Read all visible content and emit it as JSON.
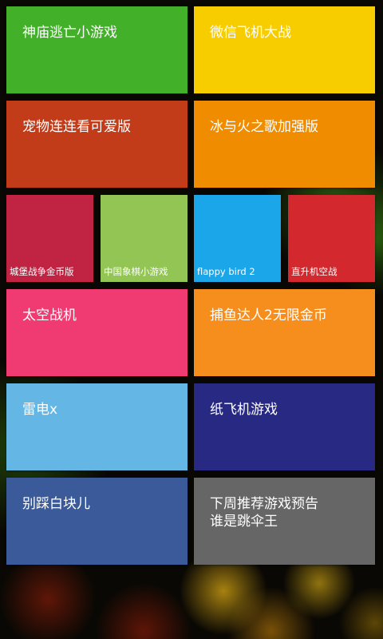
{
  "tiles": {
    "temple_run": {
      "label": "神庙逃亡小游戏",
      "color": "#43b02a"
    },
    "wechat_plane": {
      "label": "微信飞机大战",
      "color": "#f8cd00"
    },
    "pet_link": {
      "label": "宠物连连看可爱版",
      "color": "#c33c1a"
    },
    "fire_ice": {
      "label": "冰与火之歌加强版",
      "color": "#f08c00"
    },
    "castle_war": {
      "label": "城堡战争金币版",
      "color": "#c12343"
    },
    "chinese_chess": {
      "label": "中国象棋小游戏",
      "color": "#92c553"
    },
    "flappy_bird": {
      "label": "flappy bird 2",
      "color": "#1aa6e8"
    },
    "helicopter": {
      "label": "直升机空战",
      "color": "#d3282d"
    },
    "space_fighter": {
      "label": "太空战机",
      "color": "#ef3b71"
    },
    "fishing_master": {
      "label": "捕鱼达人2无限金币",
      "color": "#f68e1e"
    },
    "thunder_x": {
      "label": "雷电x",
      "color": "#64b7e4"
    },
    "paper_plane": {
      "label": "纸飞机游戏",
      "color": "#272983"
    },
    "piano_tiles": {
      "label": "别踩白块儿",
      "color": "#3b5a9a"
    },
    "next_week": {
      "label": "下周推荐游戏预告\n谁是跳伞王",
      "color": "#666666"
    }
  }
}
